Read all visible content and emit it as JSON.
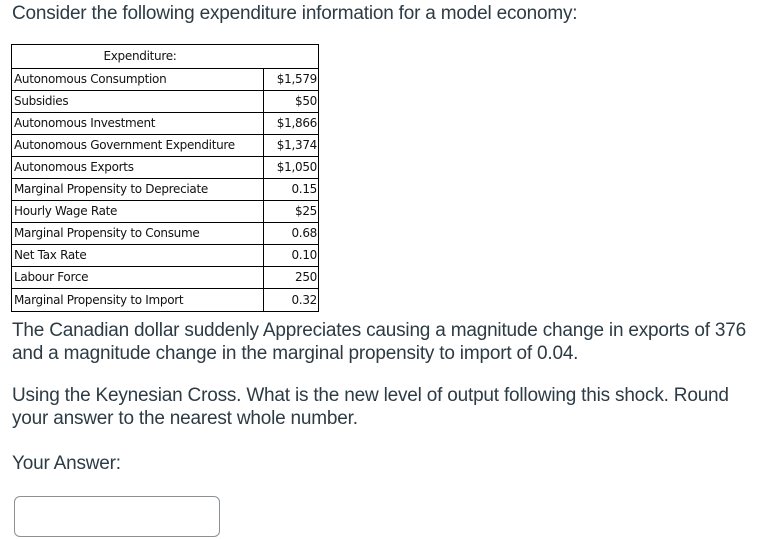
{
  "question": {
    "intro": "Consider the following expenditure information for a model economy:",
    "table": {
      "header": "Expenditure:",
      "rows": [
        {
          "label": "Autonomous Consumption",
          "value": "$1,579"
        },
        {
          "label": "Subsidies",
          "value": "$50"
        },
        {
          "label": "Autonomous Investment",
          "value": "$1,866"
        },
        {
          "label": "Autonomous Government Expenditure",
          "value": "$1,374"
        },
        {
          "label": "Autonomous Exports",
          "value": "$1,050"
        },
        {
          "label": "Marginal Propensity to Depreciate",
          "value": "0.15"
        },
        {
          "label": "Hourly Wage Rate",
          "value": "$25"
        },
        {
          "label": "Marginal Propensity to Consume",
          "value": "0.68"
        },
        {
          "label": "Net Tax Rate",
          "value": "0.10"
        },
        {
          "label": "Labour Force",
          "value": "250"
        },
        {
          "label": "Marginal Propensity to Import",
          "value": "0.32"
        }
      ]
    },
    "shock_text": "The Canadian dollar suddenly Appreciates causing a magnitude change in exports of 376 and a magnitude change in the marginal propensity to import of 0.04.",
    "prompt_text": "Using the Keynesian Cross. What is the new level of output following this shock. Round your answer to the nearest whole number.",
    "answer_label": "Your Answer:",
    "answer_value": "",
    "answer_placeholder": ""
  }
}
